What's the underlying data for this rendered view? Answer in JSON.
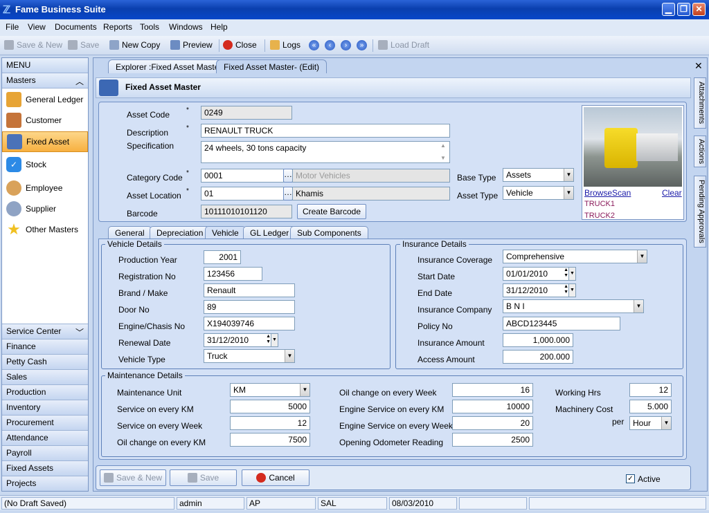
{
  "app": {
    "title": "Fame Business Suite"
  },
  "menu": [
    "File",
    "View",
    "Documents",
    "Reports",
    "Tools",
    "Windows",
    "Help"
  ],
  "toolbar": {
    "save_new": "Save & New",
    "save": "Save",
    "new_copy": "New Copy",
    "preview": "Preview",
    "close": "Close",
    "logs": "Logs",
    "load_draft": "Load Draft"
  },
  "sidebar": {
    "header": "MENU",
    "section": "Masters",
    "items": [
      "General Ledger",
      "Customer",
      "Fixed Asset",
      "Stock",
      "Employee",
      "Supplier",
      "Other Masters"
    ],
    "categories": [
      "Service Center",
      "Finance",
      "Petty Cash",
      "Sales",
      "Production",
      "Inventory",
      "Procurement",
      "Attendance",
      "Payroll",
      "Fixed Assets",
      "Projects"
    ]
  },
  "tabs": [
    "Explorer :Fixed Asset Master",
    "Fixed Asset Master- (Edit)"
  ],
  "form": {
    "title": "Fixed Asset Master",
    "labels": {
      "asset_code": "Asset Code",
      "description": "Description",
      "specification": "Specification",
      "category_code": "Category Code",
      "asset_location": "Asset Location",
      "barcode": "Barcode",
      "base_type": "Base Type",
      "asset_type": "Asset Type",
      "create_barcode": "Create Barcode",
      "required": "*"
    },
    "values": {
      "asset_code": "0249",
      "description": "RENAULT TRUCK",
      "specification": "24 wheels, 30 tons capacity",
      "category_code": "0001",
      "category_name": "Motor Vehicles",
      "asset_location": "01",
      "location_name": "Khamis",
      "barcode": "10111010101120",
      "base_type": "Assets",
      "asset_type": "Vehicle"
    },
    "image": {
      "browse": "Browse",
      "scan": "Scan",
      "clear": "Clear",
      "list": [
        "TRUCK1",
        "TRUCK2"
      ]
    }
  },
  "subtabs": [
    "General",
    "Depreciation",
    "Vehicle",
    "GL Ledger",
    "Sub Components"
  ],
  "vehicle": {
    "title": "Vehicle Details",
    "labels": [
      "Production Year",
      "Registration No",
      "Brand / Make",
      "Door No",
      "Engine/Chasis No",
      "Renewal Date",
      "Vehicle Type"
    ],
    "values": [
      "2001",
      "123456",
      "Renault",
      "89",
      "X194039746",
      "31/12/2010",
      "Truck"
    ]
  },
  "insurance": {
    "title": "Insurance Details",
    "labels": [
      "Insurance Coverage",
      "Start Date",
      "End Date",
      "Insurance Company",
      "Policy No",
      "Insurance Amount",
      "Access Amount"
    ],
    "values": [
      "Comprehensive",
      "01/01/2010",
      "31/12/2010",
      "B N I",
      "ABCD123445",
      "1,000.000",
      "200.000"
    ]
  },
  "maintenance": {
    "title": "Maintenance Details",
    "col1_labels": [
      "Maintenance Unit",
      "Service on every KM",
      "Service on every Week",
      "Oil change on every KM"
    ],
    "col1_values": [
      "KM",
      "5000",
      "12",
      "7500"
    ],
    "col2_labels": [
      "Oil change on every Week",
      "Engine Service on every KM",
      "Engine Service on every Week",
      "Opening Odometer Reading"
    ],
    "col2_values": [
      "16",
      "10000",
      "20",
      "2500"
    ],
    "col3_labels": [
      "Working Hrs",
      "Machinery Cost",
      "per"
    ],
    "col3_values": [
      "12",
      "5.000",
      "Hour"
    ]
  },
  "footer": {
    "save_new": "Save & New",
    "save": "Save",
    "cancel": "Cancel",
    "active": "Active"
  },
  "side_tabs": [
    "Attachments",
    "Actions",
    "Pending Approvals"
  ],
  "status": [
    "(No Draft Saved)",
    "admin",
    "AP",
    "SAL",
    "08/03/2010",
    "",
    ""
  ]
}
